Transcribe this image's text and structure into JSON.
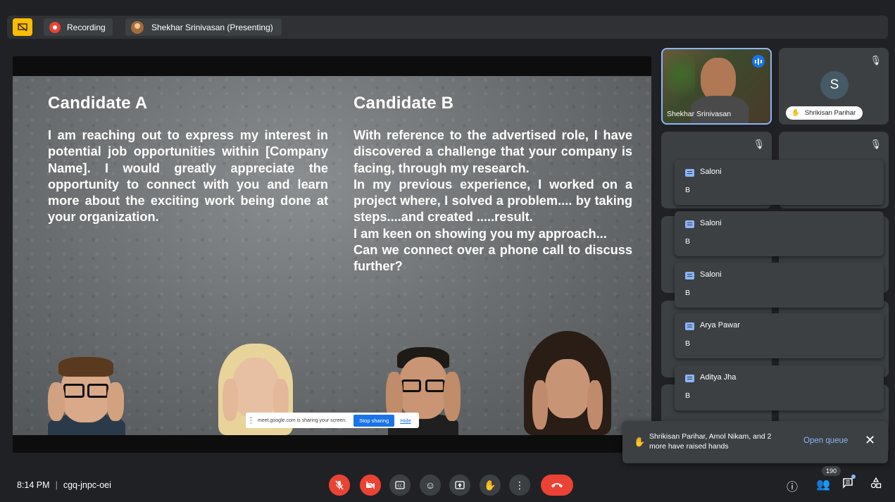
{
  "topbar": {
    "recording_label": "Recording",
    "presenter_label": "Shekhar Srinivasan (Presenting)"
  },
  "slide": {
    "candidate_a": {
      "title": "Candidate A",
      "body": "I am reaching out to express my interest in potential job opportunities within [Company Name]. I would greatly appreciate the opportunity to connect with you and learn more about the exciting work being done at your organization."
    },
    "candidate_b": {
      "title": "Candidate B",
      "body": "With reference to the advertised role, I have discovered a challenge that your company is facing, through my research.\nIn my previous experience, I worked on a project where, I solved a problem.... by taking steps....and created .....result.\nI am keen on showing you my approach...\nCan we connect over a phone call to discuss further?"
    }
  },
  "share_bar": {
    "message": "meet.google.com is sharing your screen.",
    "stop_label": "Stop sharing",
    "hide_label": "Hide"
  },
  "tiles": {
    "presenter_name": "Shekhar Srinivasan",
    "participant_initial": "S",
    "participant_name": "Shrikisan Parihar"
  },
  "chat_toasts": [
    {
      "name": "Saloni",
      "message": "B"
    },
    {
      "name": "Saloni",
      "message": "B"
    },
    {
      "name": "Saloni",
      "message": "B"
    },
    {
      "name": "Arya Pawar",
      "message": "B"
    },
    {
      "name": "Aditya Jha",
      "message": "B"
    }
  ],
  "raised_hands": {
    "text": "Shrikisan Parihar, Amol Nikam, and 2 more have raised hands",
    "open_queue_label": "Open queue"
  },
  "bottom": {
    "time": "8:14 PM",
    "meeting_code": "cgq-jnpc-oei",
    "people_count": "190"
  },
  "colors": {
    "background": "#202124",
    "tile": "#3c4043",
    "danger": "#ea4335",
    "accent": "#8ab4f8",
    "layout_button": "#fbbc04"
  }
}
